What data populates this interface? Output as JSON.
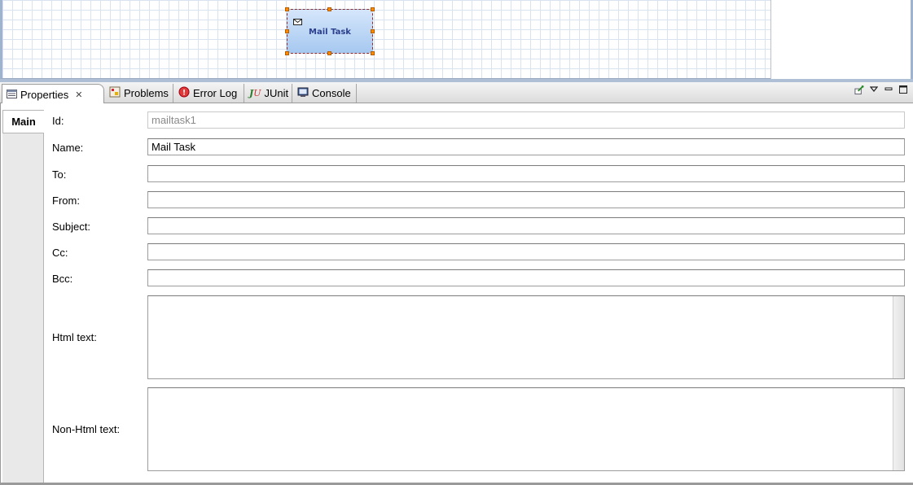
{
  "diagram": {
    "task_label": "Mail Task",
    "icon": "envelope-icon"
  },
  "tabs": [
    {
      "label": "Properties",
      "icon": "properties-icon",
      "active": true
    },
    {
      "label": "Problems",
      "icon": "problems-icon",
      "active": false
    },
    {
      "label": "Error Log",
      "icon": "error-log-icon",
      "active": false
    },
    {
      "label": "JUnit",
      "icon": "junit-icon",
      "active": false
    },
    {
      "label": "Console",
      "icon": "console-icon",
      "active": false
    }
  ],
  "view_buttons": [
    "pin-icon",
    "view-menu-icon",
    "minimize-icon",
    "maximize-icon"
  ],
  "side_tabs": [
    {
      "label": "Main"
    }
  ],
  "fields": {
    "id": {
      "label": "Id:",
      "value": "mailtask1"
    },
    "name": {
      "label": "Name:",
      "value": "Mail Task"
    },
    "to": {
      "label": "To:",
      "value": ""
    },
    "from": {
      "label": "From:",
      "value": ""
    },
    "subject": {
      "label": "Subject:",
      "value": ""
    },
    "cc": {
      "label": "Cc:",
      "value": ""
    },
    "bcc": {
      "label": "Bcc:",
      "value": ""
    },
    "html_text": {
      "label": "Html text:",
      "value": ""
    },
    "non_html_text": {
      "label": "Non-Html text:",
      "value": ""
    }
  },
  "colors": {
    "task_fill_top": "#d5e6fb",
    "task_fill_bottom": "#a6c8f0",
    "task_label": "#2a3f8e",
    "selection_handle": "#ff8c00"
  }
}
